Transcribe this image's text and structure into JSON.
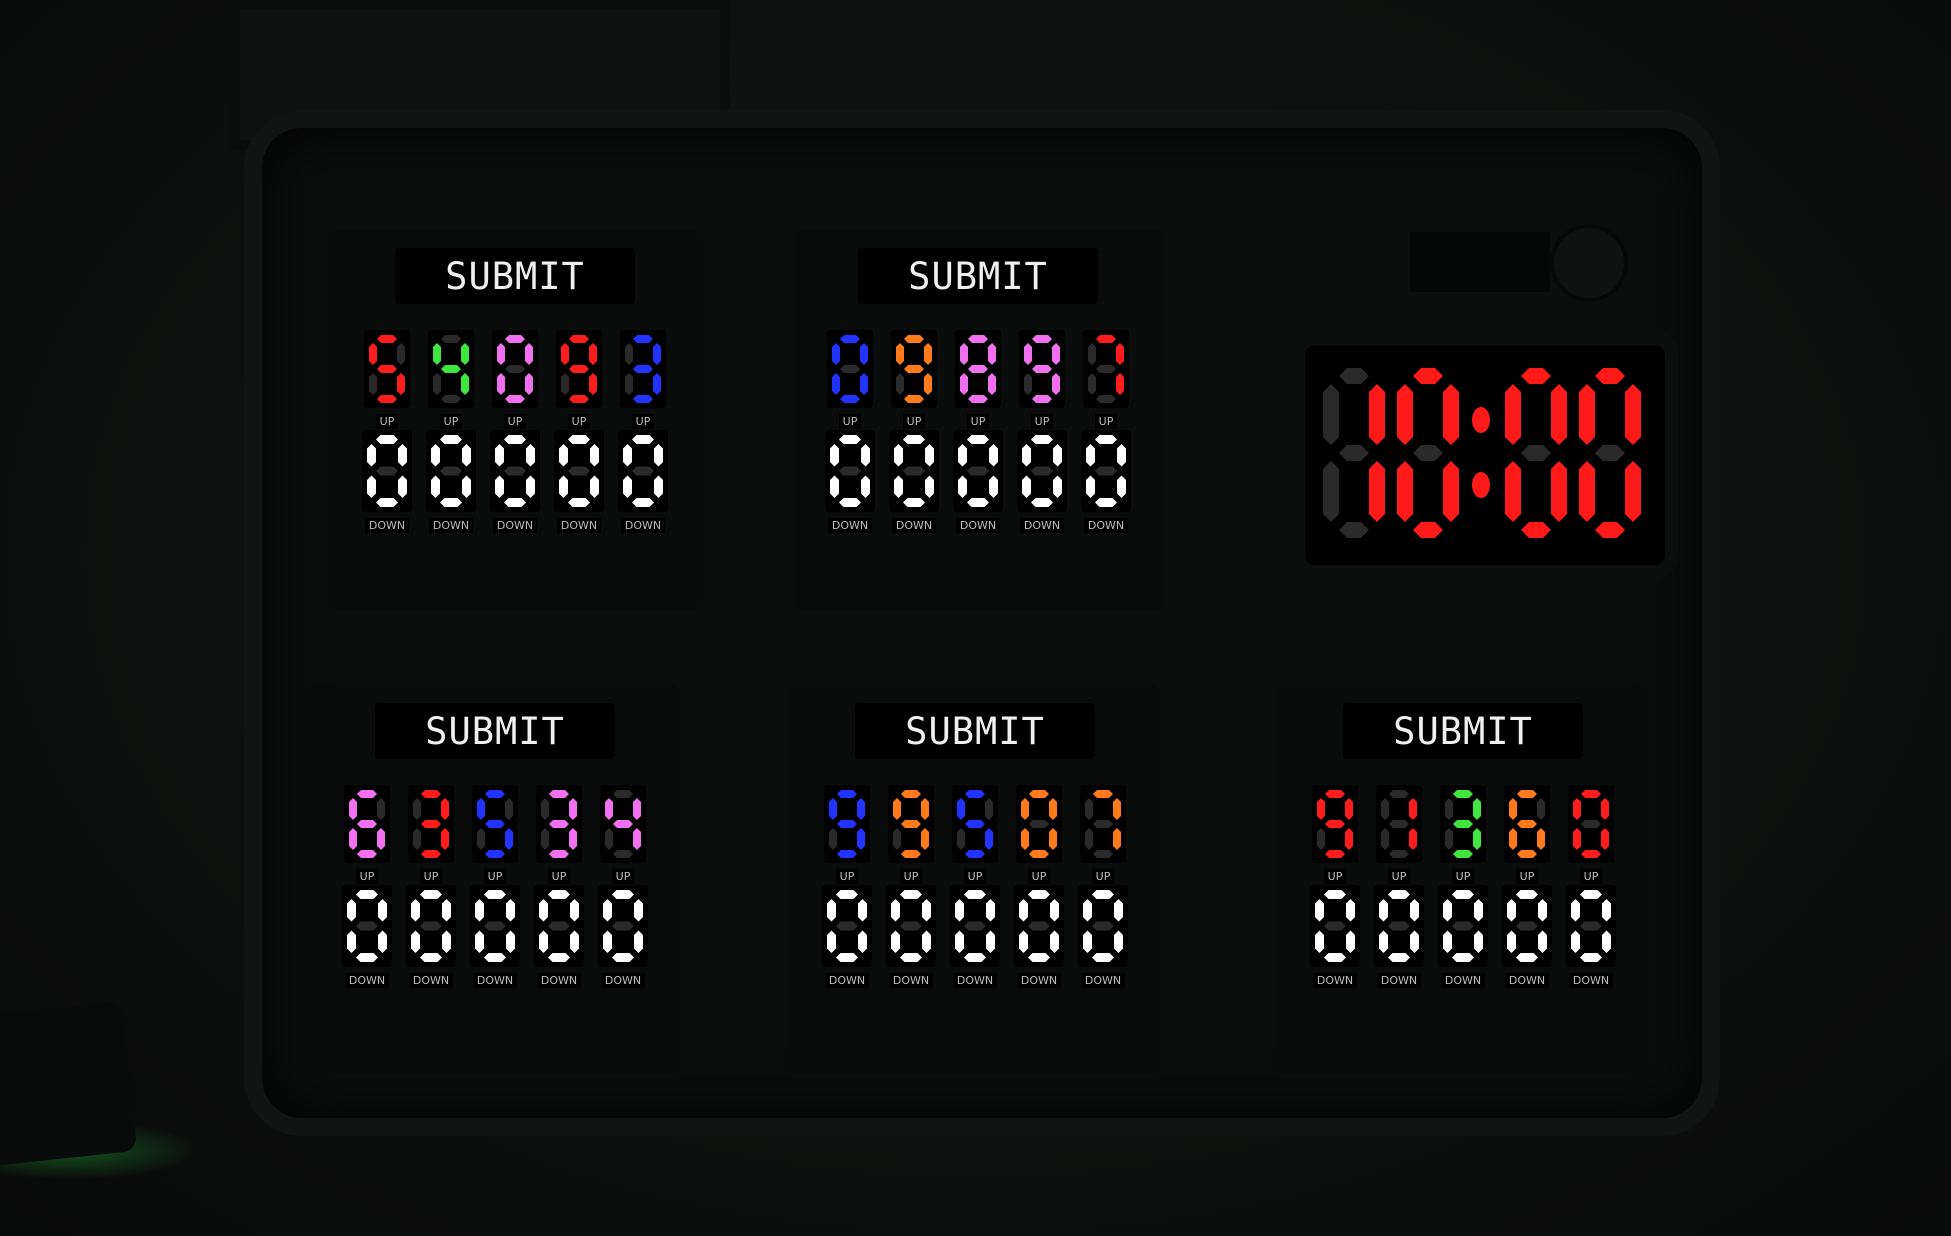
{
  "timer": {
    "minutes": "10",
    "seconds": "00",
    "color": "#ff1a1a",
    "separator": ":"
  },
  "colors": {
    "red": "#ff1c1c",
    "green": "#3ee63e",
    "pink": "#f070f0",
    "blue": "#2233ff",
    "orange": "#ff7a1a",
    "white": "#ffffff",
    "off": "#2a2a2a"
  },
  "panels": [
    {
      "submit_label": "SUBMIT",
      "up_label": "UP",
      "down_label": "DOWN",
      "code": [
        {
          "digit": "5",
          "color": "red"
        },
        {
          "digit": "4",
          "color": "green"
        },
        {
          "digit": "0",
          "color": "pink"
        },
        {
          "digit": "9",
          "color": "red"
        },
        {
          "digit": "3",
          "color": "blue"
        }
      ],
      "entry": [
        "0",
        "0",
        "0",
        "0",
        "0"
      ]
    },
    {
      "submit_label": "SUBMIT",
      "up_label": "UP",
      "down_label": "DOWN",
      "code": [
        {
          "digit": "0",
          "color": "blue"
        },
        {
          "digit": "9",
          "color": "orange"
        },
        {
          "digit": "8",
          "color": "pink"
        },
        {
          "digit": "9",
          "color": "pink"
        },
        {
          "digit": "7",
          "color": "red"
        }
      ],
      "entry": [
        "0",
        "0",
        "0",
        "0",
        "0"
      ]
    },
    {
      "submit_label": "SUBMIT",
      "up_label": "UP",
      "down_label": "DOWN",
      "code": [
        {
          "digit": "6",
          "color": "pink"
        },
        {
          "digit": "3",
          "color": "red"
        },
        {
          "digit": "5",
          "color": "blue"
        },
        {
          "digit": "3",
          "color": "pink"
        },
        {
          "digit": "4",
          "color": "pink"
        }
      ],
      "entry": [
        "0",
        "0",
        "0",
        "0",
        "0"
      ]
    },
    {
      "submit_label": "SUBMIT",
      "up_label": "UP",
      "down_label": "DOWN",
      "code": [
        {
          "digit": "9",
          "color": "blue"
        },
        {
          "digit": "9",
          "color": "orange"
        },
        {
          "digit": "5",
          "color": "blue"
        },
        {
          "digit": "0",
          "color": "orange"
        },
        {
          "digit": "7",
          "color": "orange"
        }
      ],
      "entry": [
        "0",
        "0",
        "0",
        "0",
        "0"
      ]
    },
    {
      "submit_label": "SUBMIT",
      "up_label": "UP",
      "down_label": "DOWN",
      "code": [
        {
          "digit": "9",
          "color": "red"
        },
        {
          "digit": "1",
          "color": "red"
        },
        {
          "digit": "3",
          "color": "green"
        },
        {
          "digit": "6",
          "color": "orange"
        },
        {
          "digit": "0",
          "color": "red"
        }
      ],
      "entry": [
        "0",
        "0",
        "0",
        "0",
        "0"
      ]
    }
  ]
}
